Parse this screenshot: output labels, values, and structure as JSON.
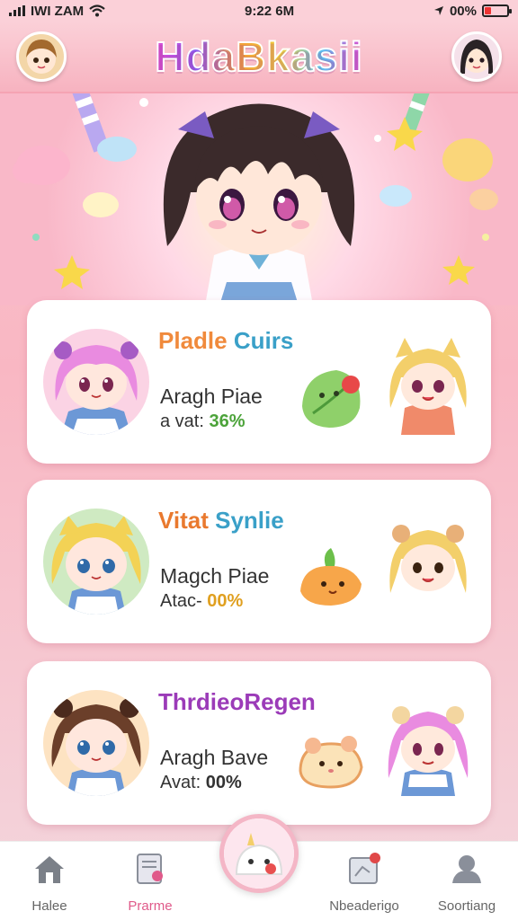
{
  "status": {
    "carrier": "IWI ZAM",
    "time": "9:22 6M",
    "battery": "00%"
  },
  "app": {
    "title": "HdaBkasii"
  },
  "cards": [
    {
      "title_a": "Pladle",
      "title_b": "Cuirs",
      "line1": "Aragh Piae",
      "line2_label": "a vat: ",
      "line2_value": "36%",
      "title_a_color": "#f08a3c",
      "title_b_color": "#3aa0c8"
    },
    {
      "title_a": "Vitat",
      "title_b": "Synlie",
      "line1": "Magch Piae",
      "line2_label": "Atac- ",
      "line2_value": "00%",
      "title_a_color": "#e9792e",
      "title_b_color": "#3aa0c8"
    },
    {
      "title_a": "ThrdieoRegen",
      "title_b": "",
      "line1": "Aragh Bave",
      "line2_label": "Avat: ",
      "line2_value": "00%",
      "title_a_color": "#9b3bb8",
      "title_b_color": "#9b3bb8"
    }
  ],
  "nav": [
    {
      "label": "Halee",
      "icon": "home-icon",
      "color": "#666"
    },
    {
      "label": "Prarme",
      "icon": "document-icon",
      "color": "#e05a8a"
    },
    {
      "label": "Nbeaderigo",
      "icon": "map-icon",
      "color": "#666"
    },
    {
      "label": "Soortiang",
      "icon": "profile-icon",
      "color": "#666"
    }
  ]
}
